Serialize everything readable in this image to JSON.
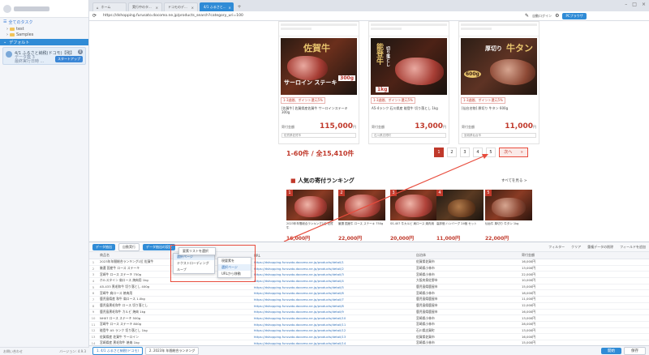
{
  "sidebar": {
    "section_title": "全てのタスク",
    "folders": [
      "test",
      "Samples"
    ],
    "project": "デフォルト",
    "task_lines": [
      "4/1 ふるさと納税(ドコモ)【残】",
      "データ数 3",
      "最終実行日時 ..."
    ],
    "task_count": "0",
    "task_button": "スタートアップ",
    "footer_left": "お問い合わせ",
    "footer_right": "バージョン: 4.9.3"
  },
  "tabs": [
    {
      "label": "ホーム"
    },
    {
      "label": "実行中のタ..."
    },
    {
      "label": "ドコモのデ..."
    },
    {
      "label": "4/1 ふるさと..."
    }
  ],
  "address": {
    "url": "https://dshopping.furusato.docomo.ne.jp/products_search?category_uri=100",
    "btn_browser": "自動ログイン",
    "btn_pc": "PCブラウザ"
  },
  "products": [
    {
      "img_text": "佐賀牛",
      "sub_text": "サーロイン ステーキ",
      "badge": "300g",
      "label": "1-3週間、ポイント還元5%",
      "desc": "[佐賀牛] 佐賀県産佐賀牛 サーロインステーキ 300g",
      "price_key": "寄付金額",
      "price": "115,000",
      "unit": "円",
      "btm": "佐賀県佐賀市"
    },
    {
      "img_text": "能登牛",
      "sub_text": "切り落とし",
      "badge": "1kg",
      "label": "1-3週間、ポイント還元5%",
      "desc": "A5-4ランク 石川県産 能登牛 切り落とし 1kg",
      "price_key": "寄付金額",
      "price": "13,000",
      "unit": "円",
      "btm": "石川県志賀町"
    },
    {
      "img_text": "牛タン",
      "sub_text": "厚切り",
      "badge": "600g",
      "label": "1-3週間、ポイント還元5%",
      "desc": "[仙台名物] 厚切り 牛タン 600g",
      "price_key": "寄付金額",
      "price": "11,000",
      "unit": "円",
      "btm": "宮城県仙台市"
    }
  ],
  "count_text": "1-60件 / 全15,410件",
  "pager": {
    "pages": [
      "1",
      "2",
      "3",
      "4",
      "5"
    ],
    "next": "次へ",
    "next_icon": "»"
  },
  "ranking": {
    "title_mark": "■",
    "title": "人気の寄付ランキング",
    "more": "すべてを見る >",
    "items": [
      {
        "num": "1",
        "text": "2023年年間総合ランキング1位 佐賀牛",
        "price": "16,000円"
      },
      {
        "num": "2",
        "text": "厳選 国産牛 ロース ステーキ 750g",
        "price": "22,000円"
      },
      {
        "num": "3",
        "text": "SS-407 牛カルビ 肩ロース 焼肉用",
        "price": "20,000円"
      },
      {
        "num": "4",
        "text": "高評価 ハンバーグ 24個 セット",
        "price": "11,000円"
      },
      {
        "num": "5",
        "text": "仙台牛 厚切り 牛タン 1kg",
        "price": "22,000円"
      }
    ]
  },
  "panel": {
    "toolbar": {
      "chip1": "データ抽出",
      "chip2": "自動実行",
      "chip3": "データ抽出の設定",
      "right": [
        "フィルター",
        "クリア",
        "重複データの削除",
        "フィールドを追加"
      ]
    },
    "columns": [
      "商品名",
      "URL",
      "自治体",
      "寄付金額"
    ],
    "rows": [
      [
        "2023年年間総合ランキング1位 佐賀牛",
        "https://dshopping.furusato.docomo.ne.jp/products/detail/1",
        "佐賀県佐賀市",
        "16,000円"
      ],
      [
        "厳選 国産牛 ロース ステーキ",
        "https://dshopping.furusato.docomo.ne.jp/products/detail/2",
        "宮崎県小林市",
        "13,000円"
      ],
      [
        "宮崎牛 ロース ステーキ 750g",
        "https://dshopping.furusato.docomo.ne.jp/products/detail/3",
        "宮崎県小林市",
        "22,000円"
      ],
      [
        "ホルスタイン 肩ロース 焼肉用 1kg",
        "https://dshopping.furusato.docomo.ne.jp/products/detail/4",
        "大阪府泉佐野市",
        "10,000円"
      ],
      [
        "A5-433 黒毛和牛 切り落とし 400g",
        "https://dshopping.furusato.docomo.ne.jp/products/detail/5",
        "鹿児島県鹿屋市",
        "15,000円"
      ],
      [
        "宮崎牛 肩ロース 焼肉用",
        "https://dshopping.furusato.docomo.ne.jp/products/detail/6",
        "宮崎県小林市",
        "18,000円"
      ],
      [
        "鹿児島県産 和牛 肩ロース 1.0kg",
        "https://dshopping.furusato.docomo.ne.jp/products/detail/7",
        "鹿児島県鹿屋市",
        "11,000円"
      ],
      [
        "鹿児島黒毛和牛 ロース 切り落とし",
        "https://dshopping.furusato.docomo.ne.jp/products/detail/8",
        "鹿児島県鹿屋市",
        "12,000円"
      ],
      [
        "鹿児島黒毛和牛 カルビ 焼肉 1kg",
        "https://dshopping.furusato.docomo.ne.jp/products/detail/9",
        "鹿児島県鹿屋市",
        "16,000円"
      ],
      [
        "NH07 ロース ステーキ 500g",
        "https://dshopping.furusato.docomo.ne.jp/products/detail/10",
        "宮崎県小林市",
        "13,000円"
      ],
      [
        "宮崎牛 ロース ステーキ 800g",
        "https://dshopping.furusato.docomo.ne.jp/products/detail/11",
        "宮崎県小林市",
        "28,000円"
      ],
      [
        "能登牛 A5 ランク 切り落とし 1kg",
        "https://dshopping.furusato.docomo.ne.jp/products/detail/12",
        "石川県志賀町",
        "13,000円"
      ],
      [
        "佐賀県産 佐賀牛 サーロイン",
        "https://dshopping.furusato.docomo.ne.jp/products/detail/13",
        "佐賀県佐賀市",
        "16,000円"
      ],
      [
        "宮崎県産 黒毛和牛 焼肉 1kg",
        "https://dshopping.furusato.docomo.ne.jp/products/detail/14",
        "宮崎県小林市",
        "15,000円"
      ]
    ],
    "menu1": [
      "選択ページ",
      "テクストローディング",
      "ループ"
    ],
    "menu2": [
      "要素リストを選択"
    ],
    "menu3": [
      "現要素を",
      "選択ページ",
      "URLから移動"
    ]
  },
  "bottom": {
    "tabs": [
      "1. 4/1 ふるさと納税(ドコモ)",
      "2. 2023年 年間総合ランキング"
    ],
    "start": "開始",
    "save": "保存"
  }
}
